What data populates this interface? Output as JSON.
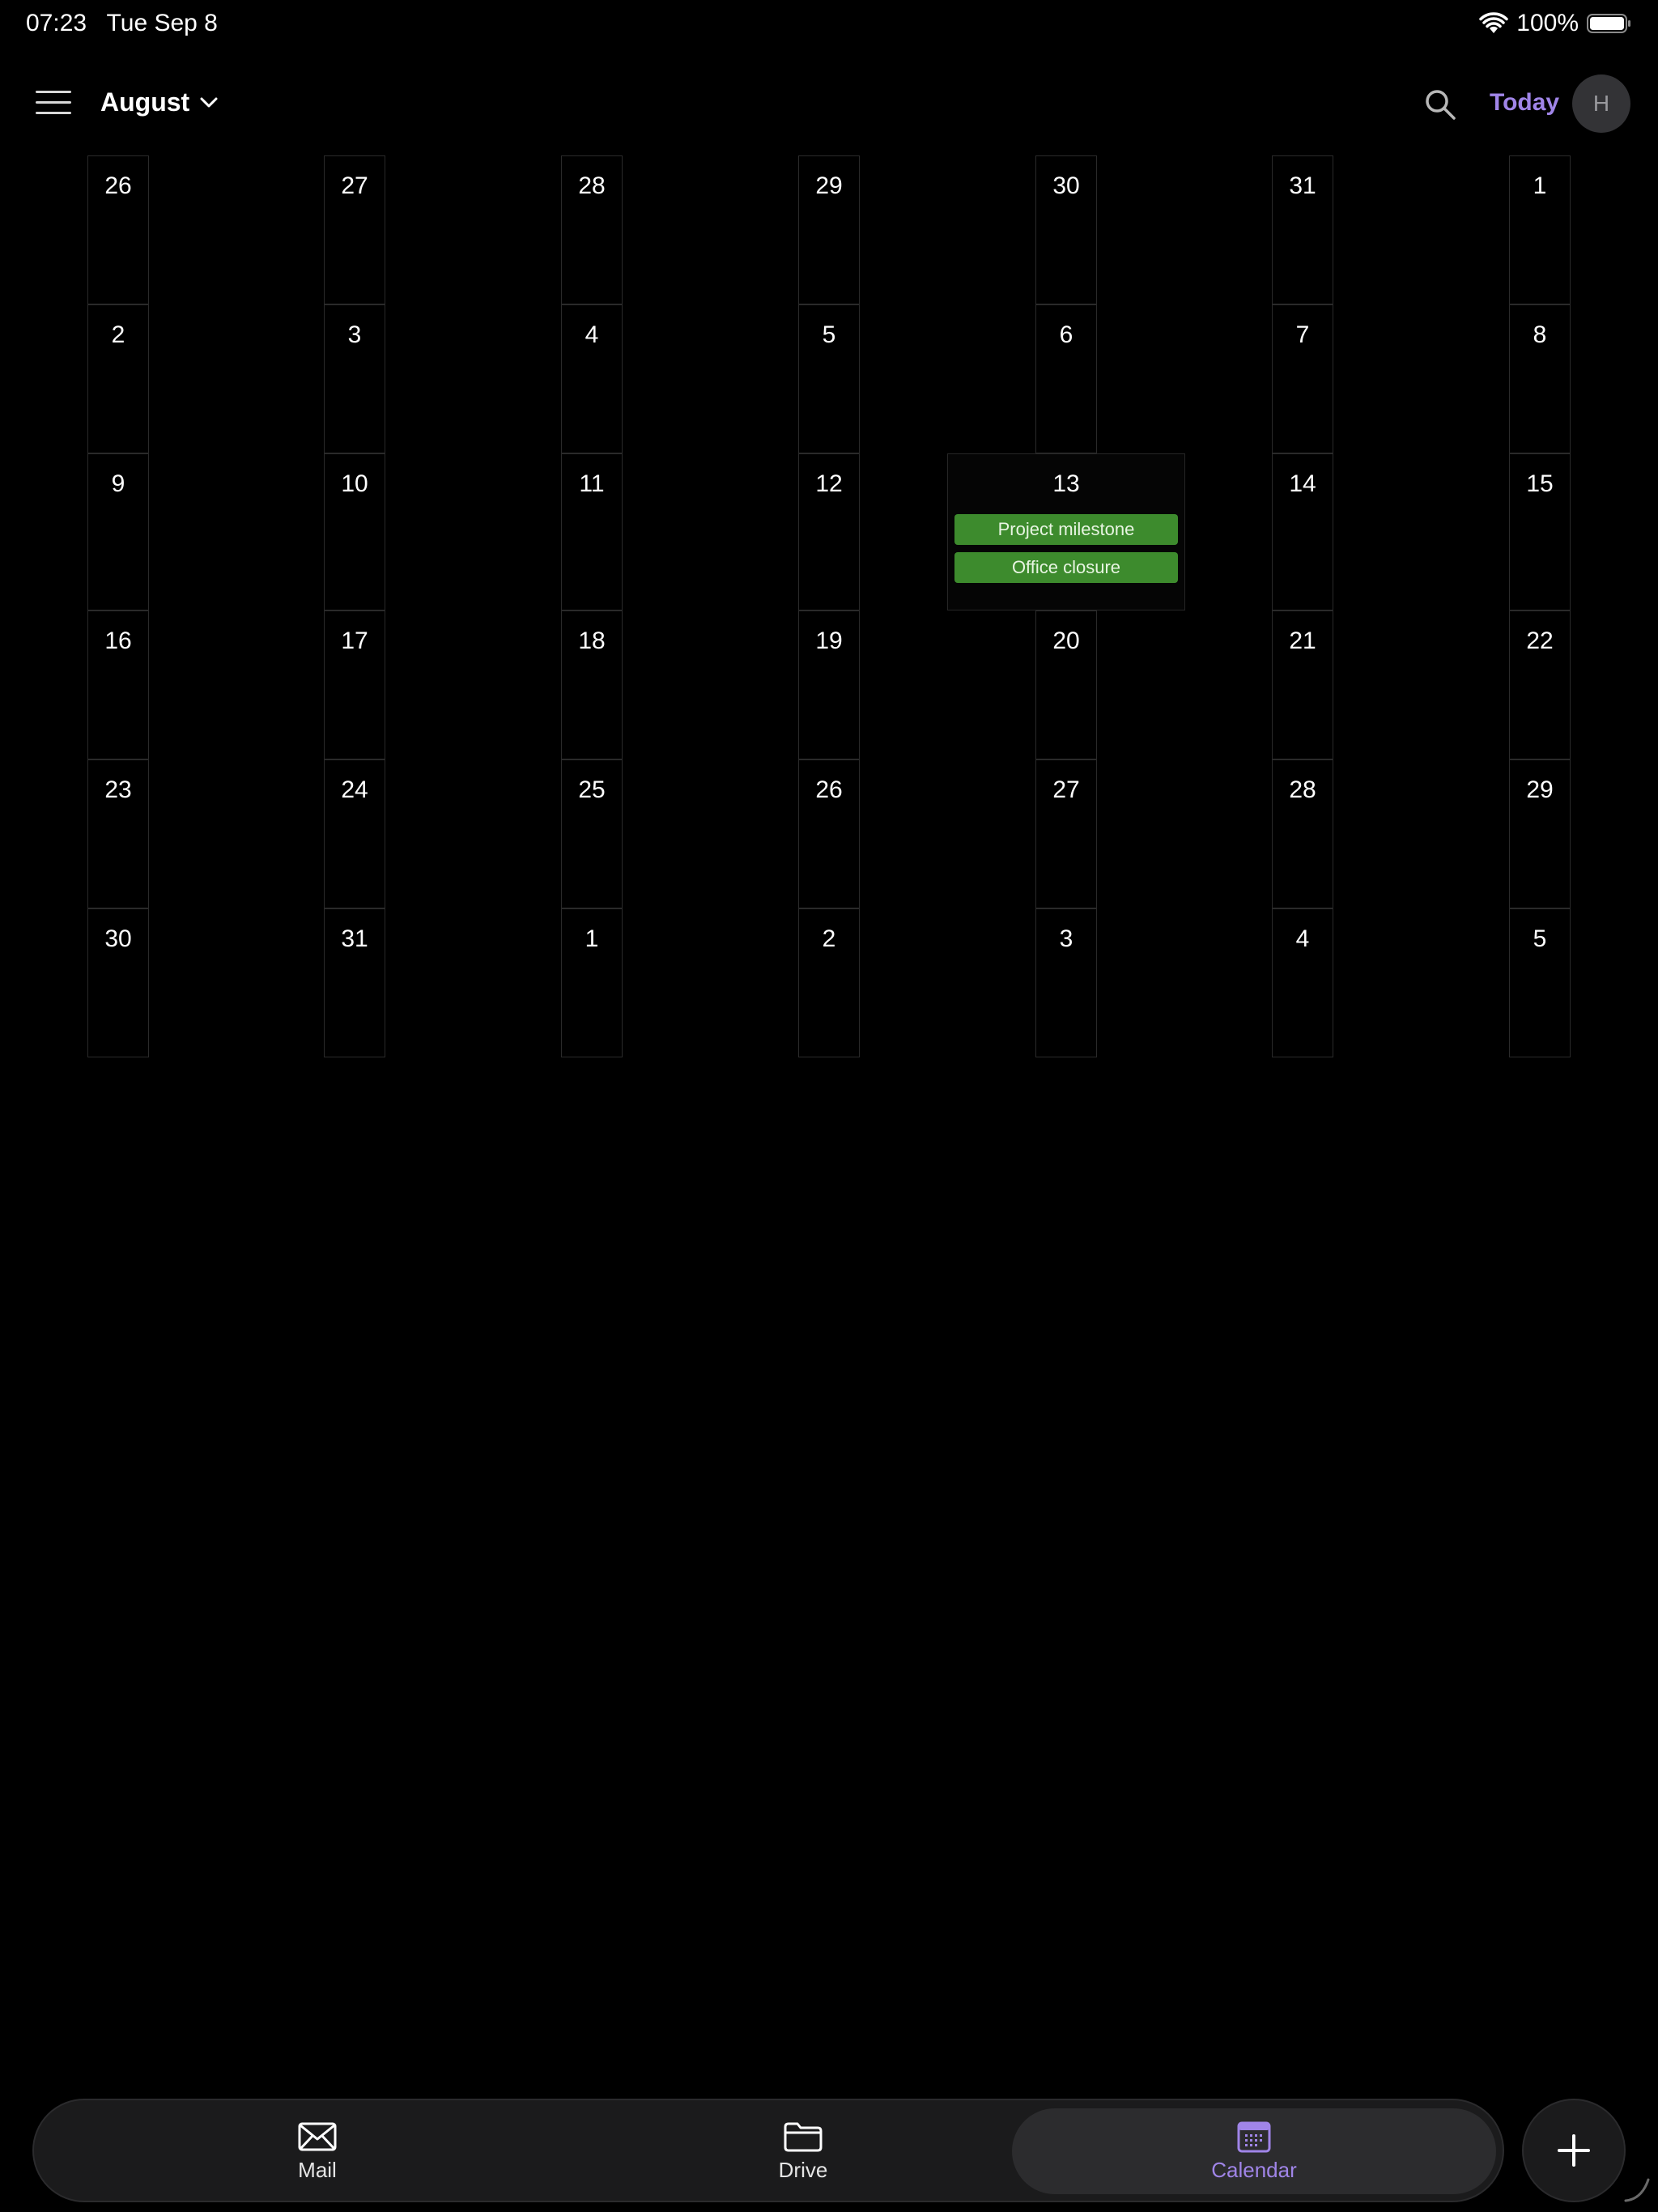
{
  "status_bar": {
    "time": "07:23",
    "date": "Tue Sep 8",
    "battery": "100%"
  },
  "header": {
    "month": "August",
    "today_label": "Today",
    "avatar_initial": "H"
  },
  "calendar": {
    "weeks": [
      [
        "26",
        "27",
        "28",
        "29",
        "30",
        "31",
        "1"
      ],
      [
        "2",
        "3",
        "4",
        "5",
        "6",
        "7",
        "8"
      ],
      [
        "9",
        "10",
        "11",
        "12",
        "13",
        "14",
        "15"
      ],
      [
        "16",
        "17",
        "18",
        "19",
        "20",
        "21",
        "22"
      ],
      [
        "23",
        "24",
        "25",
        "26",
        "27",
        "28",
        "29"
      ],
      [
        "30",
        "31",
        "1",
        "2",
        "3",
        "4",
        "5"
      ]
    ],
    "expanded_day": {
      "week": 2,
      "column": 4,
      "events": [
        {
          "title": "Project milestone",
          "color": "#3d8b2d"
        },
        {
          "title": "Office closure",
          "color": "#3d8b2d"
        }
      ]
    }
  },
  "tab_bar": {
    "tabs": [
      {
        "label": "Mail",
        "icon": "mail-icon",
        "active": false
      },
      {
        "label": "Drive",
        "icon": "folder-icon",
        "active": false
      },
      {
        "label": "Calendar",
        "icon": "calendar-icon",
        "active": true
      }
    ],
    "accent_color": "#a085e8"
  },
  "fab": {
    "icon": "plus-icon"
  }
}
